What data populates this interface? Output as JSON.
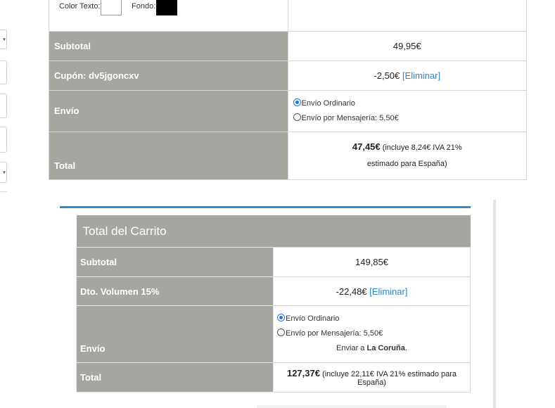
{
  "top_table": {
    "color_text_label": "Color Texto:",
    "background_label": "Fondo:",
    "subtotal_label": "Subtotal",
    "subtotal_value": "49,95€",
    "coupon_label": "Cupón: dv5jgoncxv",
    "coupon_value": "-2,50€",
    "remove_link": "[Eliminar]",
    "shipping_label": "Envío",
    "shipping_option_1": "Envío Ordinario",
    "shipping_option_2": "Envío por Mensajería: 5,50€",
    "total_label": "Total",
    "total_amount": "47,45€",
    "total_note_1": "(incluye 8,24€ IVA 21%",
    "total_note_2": "estimado para España)",
    "swatch_text_color": "#ffffff",
    "swatch_background_color": "#000000"
  },
  "cart_totals": {
    "title": "Total del Carrito",
    "subtotal_label": "Subtotal",
    "subtotal_value": "149,85€",
    "discount_label": "Dto. Volumen 15%",
    "discount_value": "-22,48€",
    "remove_link": "[Eliminar]",
    "shipping_label": "Envío",
    "shipping_option_1": "Envío Ordinario",
    "shipping_option_2": "Envío por Mensajería: 5,50€",
    "ship_to_prefix": "Enviar a",
    "ship_to_city": "La Coruña",
    "ship_to_suffix": ".",
    "total_label": "Total",
    "total_amount": "127,37€",
    "total_note": "(incluye 22,11€ IVA 21% estimado para España)"
  },
  "colors": {
    "label_bg": "#a6a6a1",
    "link": "#2a86c9",
    "accent": "#2b8ad0"
  }
}
